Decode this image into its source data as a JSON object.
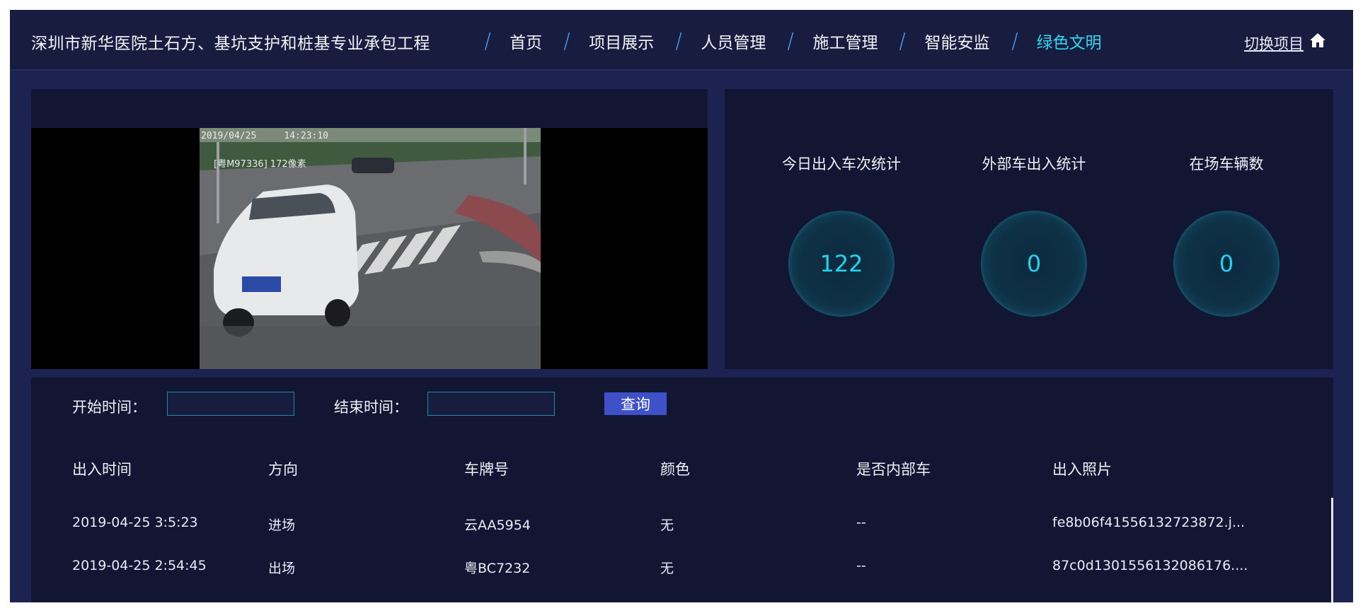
{
  "header": {
    "title": "深圳市新华医院土石方、基坑支护和桩基专业承包工程",
    "nav": [
      {
        "label": "首页",
        "active": false
      },
      {
        "label": "项目展示",
        "active": false
      },
      {
        "label": "人员管理",
        "active": false
      },
      {
        "label": "施工管理",
        "active": false
      },
      {
        "label": "智能安监",
        "active": false
      },
      {
        "label": "绿色文明",
        "active": true
      }
    ],
    "switch_label": "切换项目",
    "home_icon": "home-icon"
  },
  "camera": {
    "timestamp": "2019/04/25     14:23:10",
    "plate_overlay": "[粤M97336] 172像素"
  },
  "stats": [
    {
      "label": "今日出入车次统计",
      "value": "122"
    },
    {
      "label": "外部车出入统计",
      "value": "0"
    },
    {
      "label": "在场车辆数",
      "value": "0"
    }
  ],
  "filter": {
    "start_label": "开始时间：",
    "end_label": "结束时间：",
    "start_value": "",
    "end_value": "",
    "query_label": "查询"
  },
  "table": {
    "headers": [
      "出入时间",
      "方向",
      "车牌号",
      "颜色",
      "是否内部车",
      "出入照片"
    ],
    "rows": [
      [
        "2019-04-25 3:5:23",
        "进场",
        "云AA5954",
        "无",
        "--",
        "fe8b06f41556132723872.j..."
      ],
      [
        "2019-04-25 2:54:45",
        "出场",
        "粤BC7232",
        "无",
        "--",
        "87c0d1301556132086176...."
      ]
    ]
  },
  "colors": {
    "accent": "#2fd8f0",
    "stat_value": "#22d3ee",
    "button": "#3f51c9",
    "panel": "#121633",
    "background": "#1c2350"
  }
}
